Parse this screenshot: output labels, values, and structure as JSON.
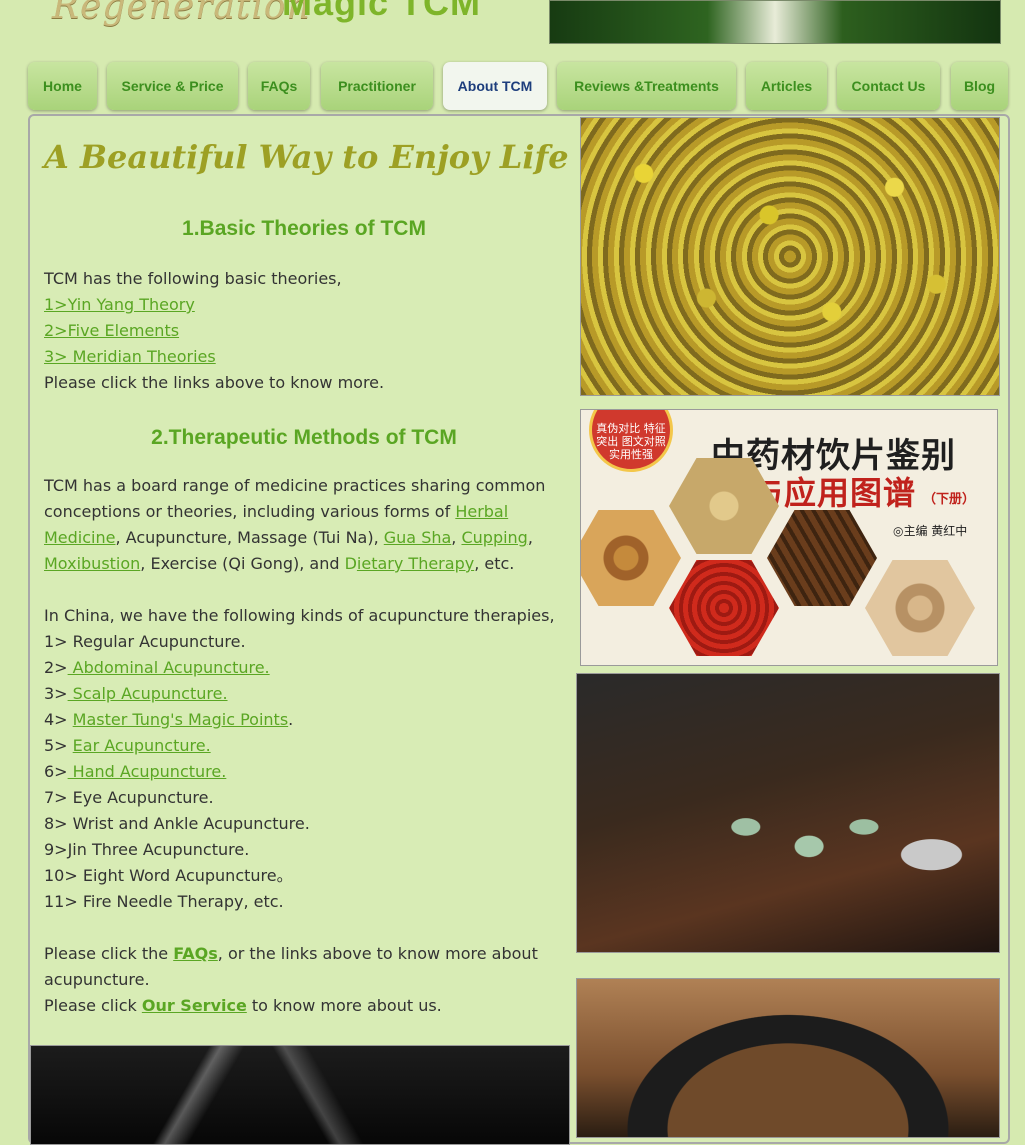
{
  "header": {
    "brand_script": "Regeneration",
    "brand_magic": "Magic TCM"
  },
  "nav": [
    {
      "label": "Home",
      "active": false
    },
    {
      "label": "Service & Price",
      "active": false
    },
    {
      "label": "FAQs",
      "active": false
    },
    {
      "label": "Practitioner",
      "active": false
    },
    {
      "label": "About TCM",
      "active": true
    },
    {
      "label": "Reviews &Treatments",
      "active": false
    },
    {
      "label": "Articles",
      "active": false
    },
    {
      "label": "Contact Us",
      "active": false
    },
    {
      "label": "Blog",
      "active": false
    }
  ],
  "page": {
    "title": "A Beautiful Way to Enjoy Life",
    "section1": {
      "heading": "1.Basic Theories of TCM",
      "intro": "TCM has the following basic theories,",
      "links": [
        "1>Yin Yang Theory",
        "2>Five Elements",
        "3> Meridian Theories"
      ],
      "outro_a": "Please click the links above",
      "outro_b": " to know more."
    },
    "section2": {
      "heading": "2.Therapeutic Methods of TCM",
      "p1_a": "TCM has a board range of medicine practices sharing common conceptions or theories, including various forms of ",
      "link_herbal": "Herbal Medicine",
      "p1_b": ", Acupuncture, Massage (Tui Na), ",
      "link_guasha": "Gua Sha",
      "p1_c": ", ",
      "link_cupping": "Cupping",
      "p1_d": ",",
      "link_moxibustion": "Moxibustion",
      "p1_e": ", Exercise (Qi Gong), and ",
      "p1_e2": "D",
      "link_dietary": "ietary Therapy",
      "p1_f": ", etc.",
      "acu_intro": "In China, we have the following kinds of acupuncture therapies,",
      "acu_list": [
        {
          "prefix": "1> Regular Acupuncture.",
          "link": "",
          "suffix": ""
        },
        {
          "prefix": "2>",
          "link": " Abdominal Acupuncture.",
          "suffix": ""
        },
        {
          "prefix": "3>",
          "link": " Scalp Acupuncture.",
          "suffix": ""
        },
        {
          "prefix": "4> ",
          "link": "Master Tung's Magic Points",
          "suffix": "."
        },
        {
          "prefix": "5> ",
          "link": "Ear Acupuncture.",
          "suffix": ""
        },
        {
          "prefix": "6>",
          "link": " Hand Acupuncture.",
          "suffix": ""
        },
        {
          "prefix": "7> Eye Acupuncture.",
          "link": "",
          "suffix": ""
        },
        {
          "prefix": "8> Wrist and Ankle Acupuncture.",
          "link": "",
          "suffix": ""
        },
        {
          "prefix": "9>Jin Three Acupuncture.",
          "link": "",
          "suffix": ""
        },
        {
          "prefix": "10> Eight Word Acupuncture。",
          "link": "",
          "suffix": ""
        },
        {
          "prefix": "11> Fire Needle Therapy, etc.",
          "link": "",
          "suffix": ""
        }
      ],
      "faq_a": "Please click the ",
      "faq_link": "FAQs",
      "faq_b": ", or the links above  to know more about acupuncture.",
      "service_a": "Please click ",
      "service_link": "Our Service",
      "service_b": " to know more about us."
    }
  },
  "book": {
    "title": "中药材饮片鉴别",
    "subtitle": "与应用图谱",
    "volume": "（下册）",
    "editor": "◎主编    黄红中",
    "badge": "真伪对比 特征突出 图文对照 实用性强"
  },
  "colors": {
    "background": "#d6eab0",
    "accent_green": "#5aa623",
    "title_olive": "#9da024",
    "nav_active_text": "#1d3d7c"
  }
}
